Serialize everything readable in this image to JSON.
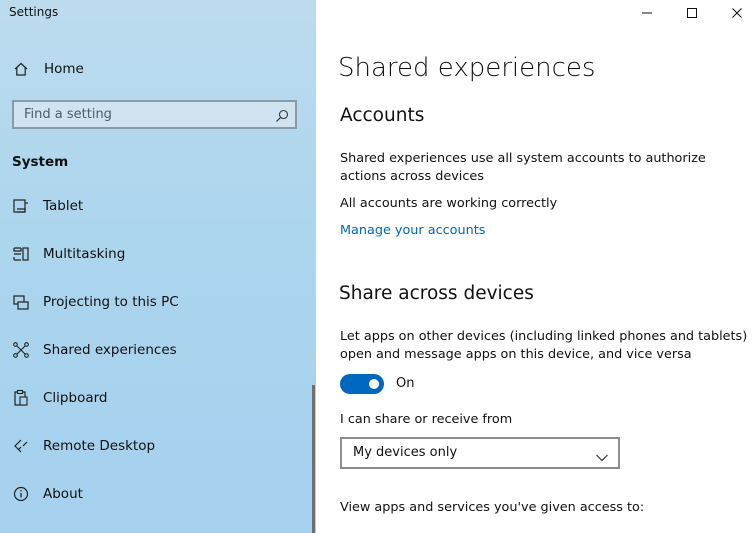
{
  "window": {
    "title": "Settings"
  },
  "sidebar": {
    "home_label": "Home",
    "search": {
      "placeholder": "Find a setting"
    },
    "section_title": "System",
    "items": [
      {
        "label": "Tablet",
        "icon": "tablet-icon"
      },
      {
        "label": "Multitasking",
        "icon": "multitasking-icon"
      },
      {
        "label": "Projecting to this PC",
        "icon": "projecting-icon"
      },
      {
        "label": "Shared experiences",
        "icon": "shared-experiences-icon"
      },
      {
        "label": "Clipboard",
        "icon": "clipboard-icon"
      },
      {
        "label": "Remote Desktop",
        "icon": "remote-desktop-icon"
      },
      {
        "label": "About",
        "icon": "info-icon"
      }
    ]
  },
  "main": {
    "title": "Shared experiences",
    "accounts": {
      "heading": "Accounts",
      "description": "Shared experiences use all system accounts to authorize actions across devices",
      "status": "All accounts are working correctly",
      "manage_link": "Manage your accounts"
    },
    "share": {
      "heading": "Share across devices",
      "description": "Let apps on other devices (including linked phones and tablets) open and message apps on this device, and vice versa",
      "toggle_state": "On",
      "share_label": "I can share or receive from",
      "share_selected": "My devices only",
      "apps_label": "View apps and services you've given access to:"
    }
  },
  "colors": {
    "accent": "#0067c0",
    "link": "#0067b8",
    "sidebar_background": "#a9d3ee"
  }
}
